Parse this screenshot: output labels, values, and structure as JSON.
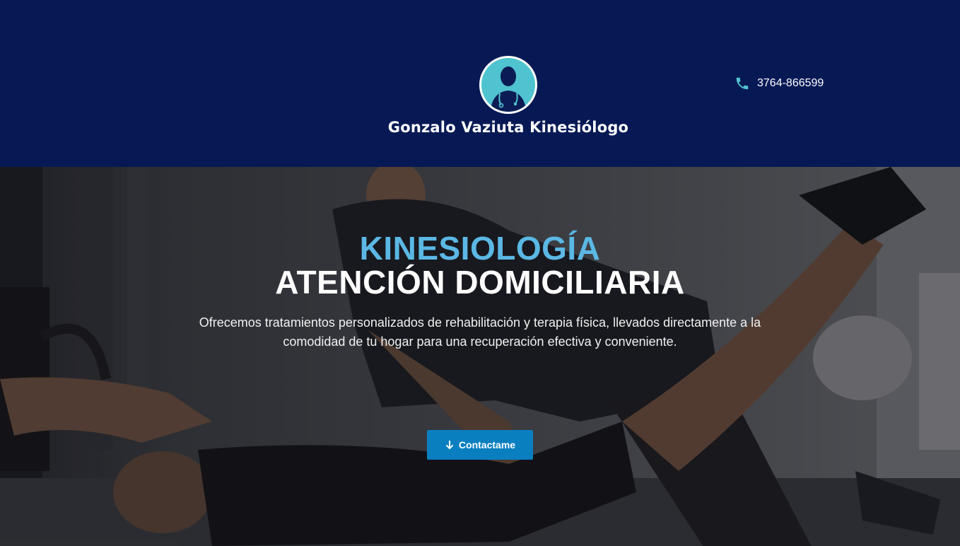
{
  "header": {
    "brand_name": "Gonzalo Vaziuta Kinesiólogo",
    "logo_icon": "doctor-avatar-icon",
    "phone": {
      "icon": "phone-icon",
      "number": "3764-866599"
    }
  },
  "hero": {
    "title_line_1": "KINESIOLOGÍA",
    "title_line_2": "ATENCIÓN DOMICILIARIA",
    "description": "Ofrecemos tratamientos personalizados de rehabilitación y terapia física, llevados directamente a la comodidad de tu hogar para una recuperación efectiva y conveniente.",
    "cta": {
      "label": "Contactame",
      "icon": "arrow-down-icon"
    }
  },
  "colors": {
    "header_bg": "#071955",
    "accent_blue": "#5bb8e4",
    "button_blue": "#0a7fc0",
    "logo_teal": "#4fc3cf"
  }
}
